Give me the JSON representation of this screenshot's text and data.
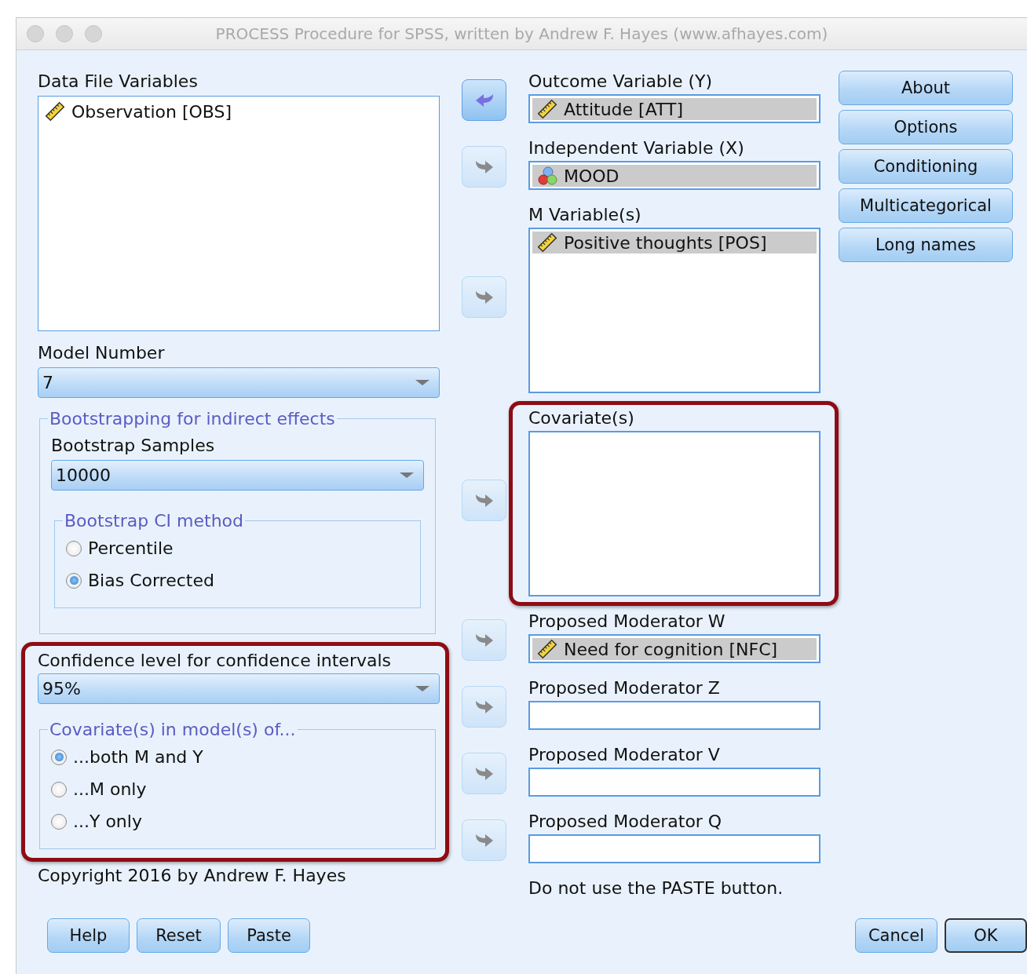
{
  "window": {
    "title": "PROCESS Procedure for SPSS, written by Andrew F. Hayes (www.afhayes.com)"
  },
  "data_file_variables": {
    "label": "Data File Variables",
    "items": [
      {
        "name": "Observation [OBS]",
        "kind": "scale"
      }
    ]
  },
  "model_number": {
    "label": "Model Number",
    "value": "7"
  },
  "bootstrapping": {
    "title": "Bootstrapping for indirect effects",
    "samples_label": "Bootstrap Samples",
    "samples_value": "10000",
    "ci_method": {
      "title": "Bootstrap CI method",
      "options": [
        {
          "label": "Percentile",
          "selected": false
        },
        {
          "label": "Bias Corrected",
          "selected": true
        }
      ]
    }
  },
  "confidence": {
    "highlighted": true,
    "label": "Confidence level for confidence intervals",
    "value": "95%",
    "covariates_in": {
      "title": "Covariate(s) in model(s) of...",
      "options": [
        {
          "label": "...both M and Y",
          "selected": true
        },
        {
          "label": "...M only",
          "selected": false
        },
        {
          "label": "...Y only",
          "selected": false
        }
      ]
    }
  },
  "copyright": "Copyright 2016 by Andrew F. Hayes",
  "variable_slots": [
    {
      "label": "Outcome Variable (Y)",
      "kind": "single",
      "arrow_reversed": true,
      "arrow_enabled": true,
      "highlighted": false,
      "items": [
        {
          "name": "Attitude [ATT]",
          "kind": "scale"
        }
      ]
    },
    {
      "label": "Independent Variable (X)",
      "kind": "single",
      "arrow_reversed": false,
      "arrow_enabled": false,
      "highlighted": false,
      "items": [
        {
          "name": "MOOD",
          "kind": "nominal"
        }
      ]
    },
    {
      "label": "M Variable(s)",
      "kind": "list",
      "arrow_reversed": false,
      "arrow_enabled": false,
      "highlighted": false,
      "items": [
        {
          "name": "Positive thoughts [POS]",
          "kind": "scale"
        }
      ]
    },
    {
      "label": "Covariate(s)",
      "kind": "list",
      "arrow_reversed": false,
      "arrow_enabled": false,
      "highlighted": true
    },
    {
      "label": "Proposed Moderator W",
      "kind": "single",
      "arrow_reversed": false,
      "arrow_enabled": false,
      "highlighted": false,
      "items": [
        {
          "name": "Need for cognition [NFC]",
          "kind": "scale"
        }
      ]
    },
    {
      "label": "Proposed Moderator Z",
      "kind": "single",
      "arrow_reversed": false,
      "arrow_enabled": false,
      "highlighted": false
    },
    {
      "label": "Proposed Moderator V",
      "kind": "single",
      "arrow_reversed": false,
      "arrow_enabled": false,
      "highlighted": false
    },
    {
      "label": "Proposed Moderator Q",
      "kind": "single",
      "arrow_reversed": false,
      "arrow_enabled": false,
      "highlighted": false
    }
  ],
  "note": "Do not use the PASTE button.",
  "side_buttons": [
    "About",
    "Options",
    "Conditioning",
    "Multicategorical",
    "Long names"
  ],
  "bottom_left_buttons": [
    "Help",
    "Reset",
    "Paste"
  ],
  "bottom_right_buttons": [
    {
      "label": "Cancel",
      "default": false
    },
    {
      "label": "OK",
      "default": true
    }
  ]
}
